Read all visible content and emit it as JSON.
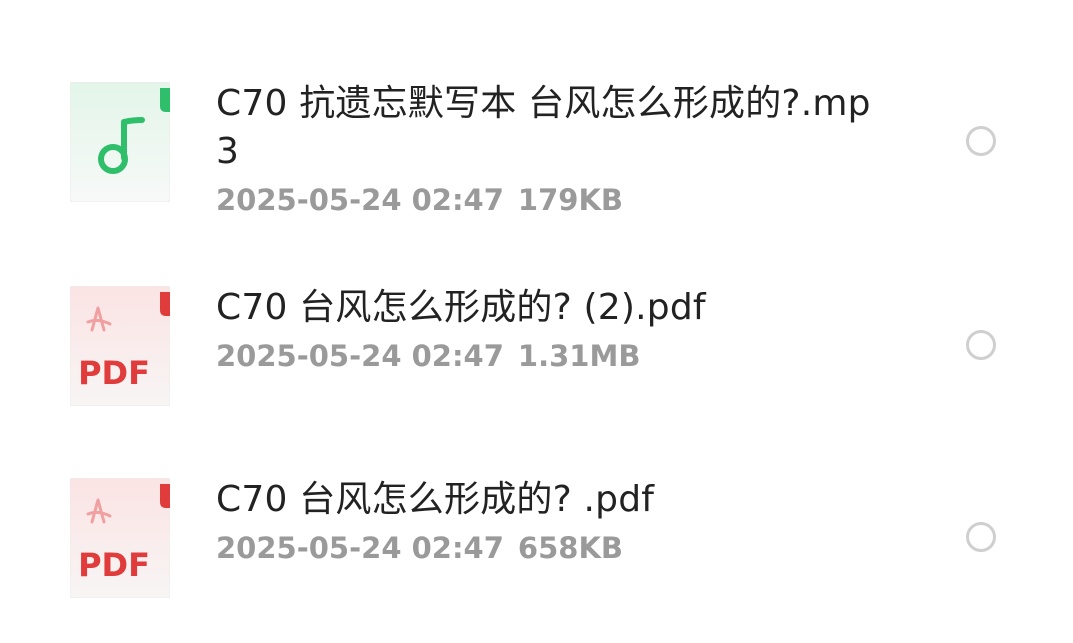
{
  "files": [
    {
      "name": "C70 抗遗忘默写本 台风怎么形成的?.mp3",
      "date": "2025-05-24 02:47",
      "size": "179KB",
      "icon": "music-note-icon",
      "accent": "#2fbf6a"
    },
    {
      "name": "C70 台风怎么形成的? (2).pdf",
      "date": "2025-05-24 02:47",
      "size": "1.31MB",
      "icon": "pdf-icon",
      "icon_label": "PDF",
      "accent": "#e03c3c"
    },
    {
      "name": "C70 台风怎么形成的? .pdf",
      "date": "2025-05-24 02:47",
      "size": "658KB",
      "icon": "pdf-icon",
      "icon_label": "PDF",
      "accent": "#e03c3c"
    }
  ]
}
